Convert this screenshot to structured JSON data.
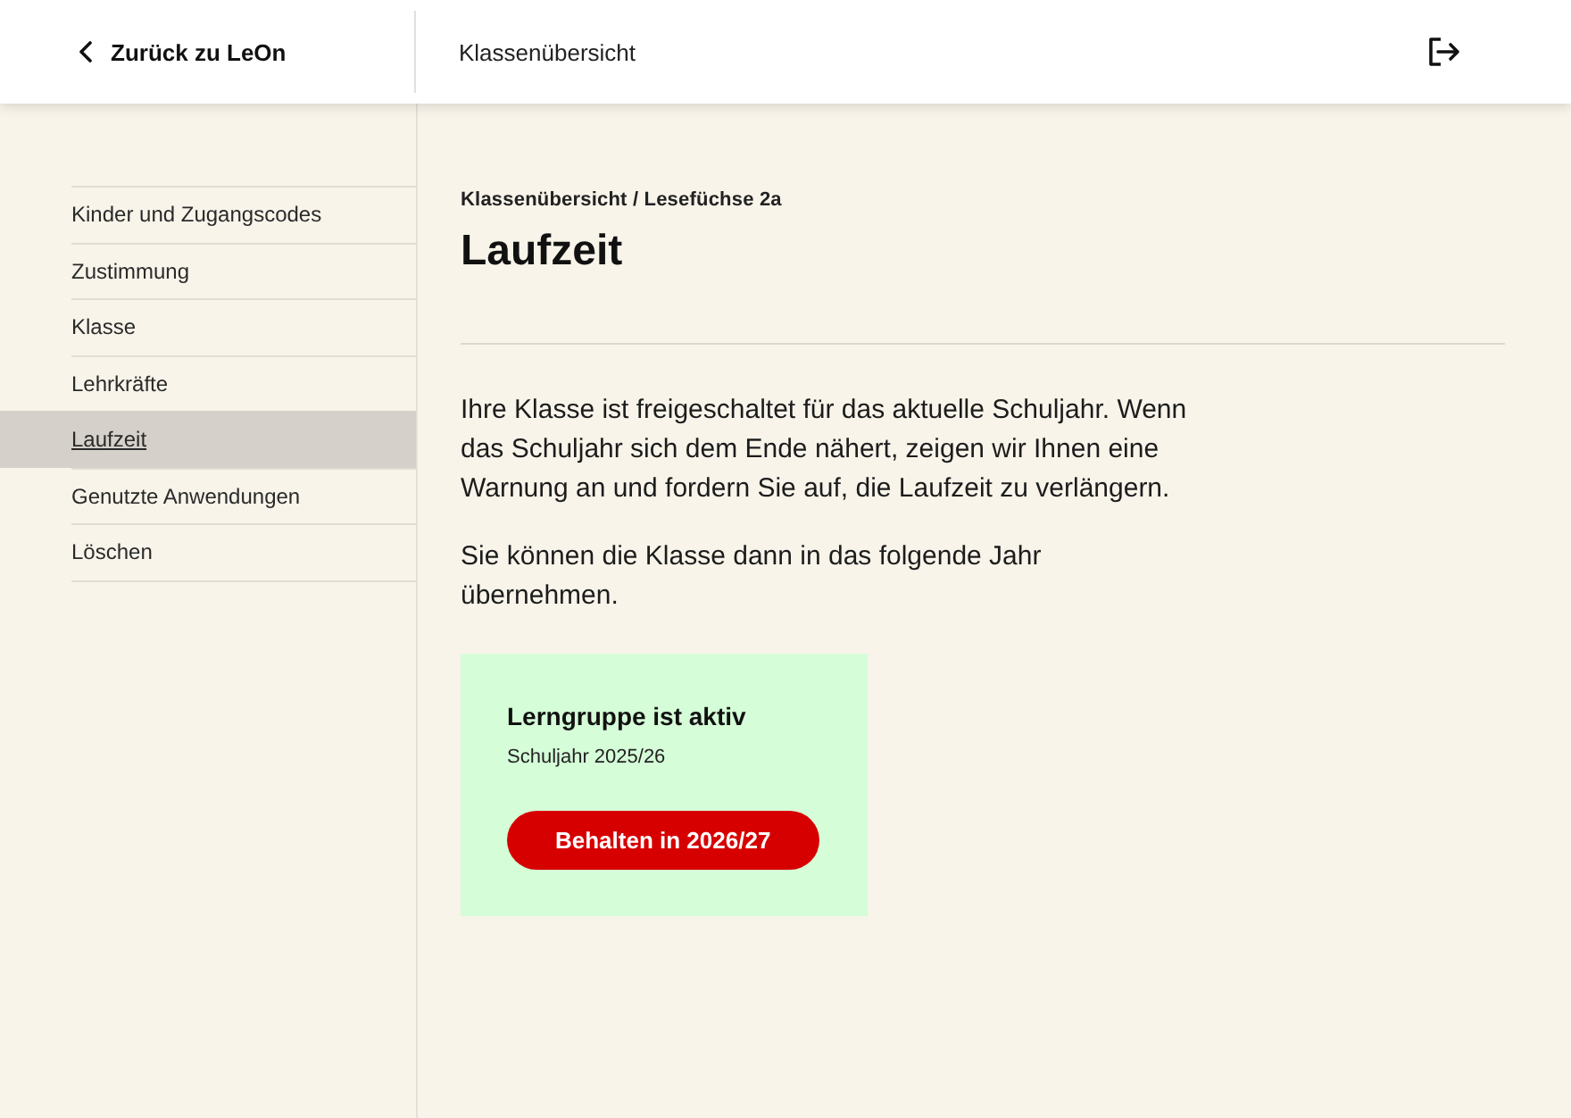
{
  "header": {
    "back_link": "Zurück zu LeOn",
    "title": "Klassenübersicht"
  },
  "sidebar": {
    "items": [
      {
        "label": "Kinder und Zugangscodes",
        "selected": false
      },
      {
        "label": "Zustimmung",
        "selected": false
      },
      {
        "label": "Klasse",
        "selected": false
      },
      {
        "label": "Lehrkräfte",
        "selected": false
      },
      {
        "label": "Laufzeit",
        "selected": true
      },
      {
        "label": "Genutzte Anwendungen",
        "selected": false
      },
      {
        "label": "Löschen",
        "selected": false
      }
    ]
  },
  "main": {
    "breadcrumb": "Klassenübersicht / Lesefüchse 2a",
    "title": "Laufzeit",
    "paragraphs": [
      "Ihre Klasse ist freigeschaltet für das aktuelle Schuljahr. Wenn das Schuljahr sich dem Ende nähert, zeigen wir Ihnen eine Warnung an und fordern Sie auf, die Laufzeit zu verlängern.",
      "Sie können die Klasse dann in das folgende Jahr übernehmen."
    ],
    "status_card": {
      "title": "Lerngruppe ist aktiv",
      "subtitle": "Schuljahr 2025/26",
      "button": "Behalten in 2026/27"
    }
  }
}
